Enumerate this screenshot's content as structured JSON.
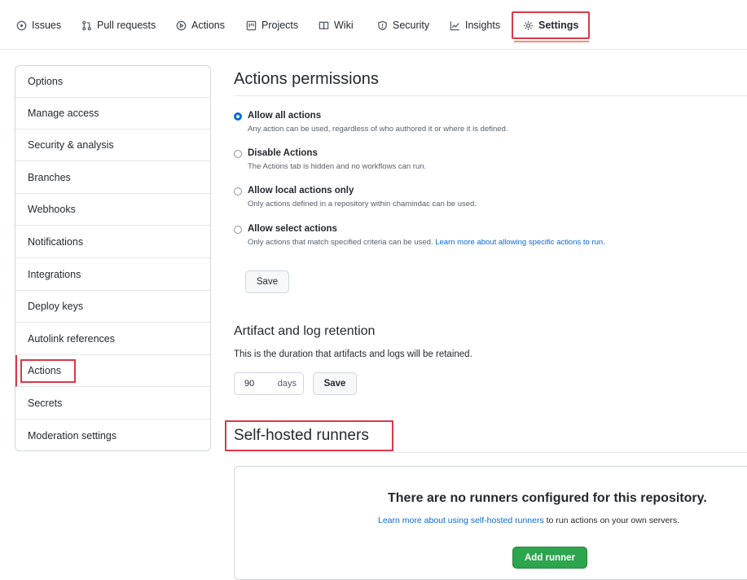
{
  "nav": {
    "tabs": [
      {
        "label": "Issues",
        "icon": "issue-icon"
      },
      {
        "label": "Pull requests",
        "icon": "pull-request-icon"
      },
      {
        "label": "Actions",
        "icon": "play-icon"
      },
      {
        "label": "Projects",
        "icon": "project-icon"
      },
      {
        "label": "Wiki",
        "icon": "book-icon"
      },
      {
        "label": "Security",
        "icon": "shield-icon"
      },
      {
        "label": "Insights",
        "icon": "graph-icon"
      },
      {
        "label": "Settings",
        "icon": "gear-icon"
      }
    ],
    "active": "Settings"
  },
  "sidebar": {
    "items": [
      {
        "label": "Options"
      },
      {
        "label": "Manage access"
      },
      {
        "label": "Security & analysis"
      },
      {
        "label": "Branches"
      },
      {
        "label": "Webhooks"
      },
      {
        "label": "Notifications"
      },
      {
        "label": "Integrations"
      },
      {
        "label": "Deploy keys"
      },
      {
        "label": "Autolink references"
      },
      {
        "label": "Actions"
      },
      {
        "label": "Secrets"
      },
      {
        "label": "Moderation settings"
      }
    ],
    "selected": "Actions"
  },
  "permissions": {
    "title": "Actions permissions",
    "options": [
      {
        "title": "Allow all actions",
        "desc": "Any action can be used, regardless of who authored it or where it is defined.",
        "checked": true
      },
      {
        "title": "Disable Actions",
        "desc": "The Actions tab is hidden and no workflows can run.",
        "checked": false
      },
      {
        "title": "Allow local actions only",
        "desc": "Only actions defined in a repository within chamindac can be used.",
        "checked": false
      },
      {
        "title": "Allow select actions",
        "desc": "Only actions that match specified criteria can be used.",
        "link": "Learn more about allowing specific actions to run.",
        "checked": false
      }
    ],
    "save_label": "Save"
  },
  "retention": {
    "title": "Artifact and log retention",
    "desc": "This is the duration that artifacts and logs will be retained.",
    "value": "90",
    "unit": "days",
    "save_label": "Save"
  },
  "runners": {
    "title": "Self-hosted runners",
    "empty_title": "There are no runners configured for this repository.",
    "empty_link": "Learn more about using self-hosted runners",
    "empty_suffix": " to run actions on your own servers.",
    "add_label": "Add runner"
  },
  "colors": {
    "accent": "#0969da",
    "highlight": "#d73a49",
    "primary_button": "#2da44e"
  }
}
